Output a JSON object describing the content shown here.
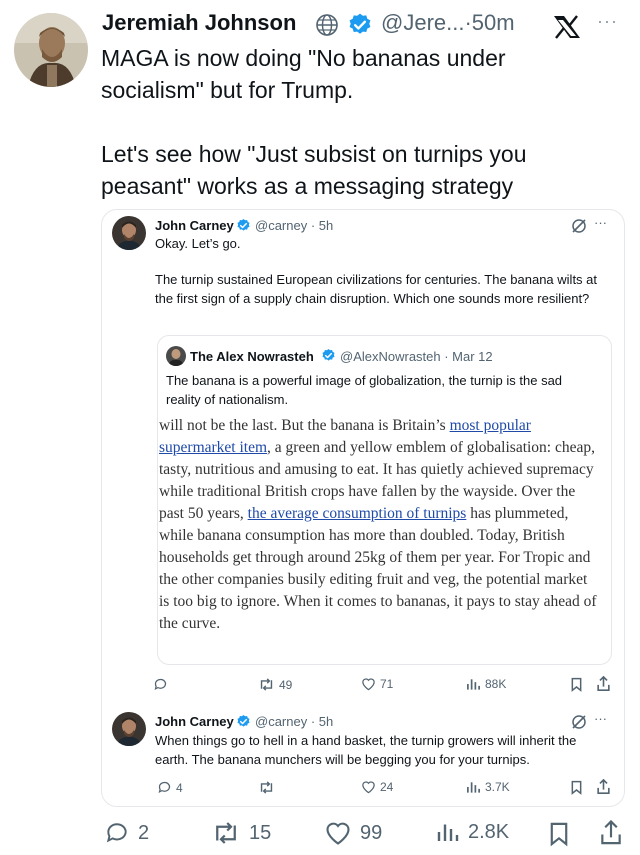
{
  "tweet": {
    "author_name": "Jeremiah Johnson",
    "author_handle": "@Jere...·50m",
    "text": "MAGA is now doing \"No bananas under socialism\" but for Trump.\n\nLet's see how \"Just subsist on turnips you peasant\" works as a messaging strategy",
    "metrics": {
      "replies": "2",
      "reposts": "15",
      "likes": "99",
      "views": "2.8K"
    }
  },
  "quoted": {
    "author_name": "John Carney",
    "author_handle": "@carney · 5h",
    "text_1": "Okay. Let’s go.",
    "text_2": "The turnip sustained European civilizations for centuries. The banana wilts at the first sign of a supply chain disruption. Which one sounds more resilient?",
    "inner": {
      "author_name": "The Alex Nowrasteh",
      "author_handle": "@AlexNowrasteh · Mar 12",
      "text": "The banana is a powerful image of globalization, the turnip is the sad reality of nationalism.",
      "article": {
        "p1": "will not be the last. But the banana is Britain’s ",
        "link1": "most popular supermarket item",
        "p2": ", a green and yellow emblem of globalisation: cheap, tasty, nutritious and amusing to eat. It has quietly achieved supremacy while traditional British crops have fallen by the wayside. Over the past 50 years, ",
        "link2": "the average consumption of turnips",
        "p3": " has plummeted, while banana consumption has more than doubled. Today, British households get through around 25kg of them per year. For Tropic and the other companies busily editing fruit and veg, the potential market is too big to ignore. When it comes to bananas, it pays to stay ahead of the curve."
      }
    },
    "metrics": {
      "replies": "",
      "reposts": "49",
      "likes": "71",
      "views": "88K"
    }
  },
  "reply": {
    "author_name": "John Carney",
    "author_handle": "@carney · 5h",
    "text": "When things go to hell in a hand basket, the turnip growers will inherit the earth. The banana munchers will be begging you for your turnips.",
    "metrics": {
      "replies": "4",
      "reposts": "",
      "likes": "24",
      "views": "3.7K"
    }
  },
  "ui": {
    "more": "···",
    "x_logo": "X"
  },
  "colors": {
    "verified": "#1d9bf0",
    "text": "#0f1419",
    "muted": "#536471",
    "link": "#1f4aa8",
    "border": "#e5e7ea"
  }
}
